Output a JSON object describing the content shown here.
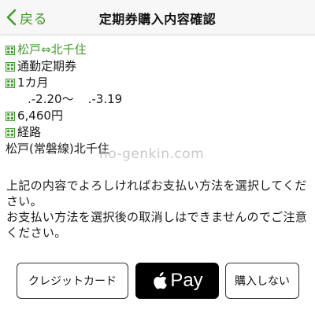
{
  "nav": {
    "back_label": "戻る",
    "title": "定期券購入内容確認"
  },
  "details": {
    "route": "松戸⇔北千住",
    "ticket_type": "通勤定期券",
    "period": "1カ月",
    "date_from": ".-2.20〜",
    "date_to": ".-3.19",
    "price": "6,460円",
    "path_label": "経路",
    "path_value": "松戸(常磐線)北千住"
  },
  "watermark": "no-genkin.com",
  "message": {
    "line1": "上記の内容でよろしければお支払い方法を選択してください。",
    "line2": "お支払い方法を選択後の取消しはできませんのでご注意ください。"
  },
  "buttons": {
    "credit_card": "クレジットカード",
    "apple_pay": "Pay",
    "cancel": "購入しない"
  },
  "colors": {
    "accent": "#3f9a2a",
    "navbar_bg": "#f7f7f7",
    "pay_button_bg": "#000000"
  },
  "icons": {
    "back": "chevron-left-icon",
    "bullet": "grid-square-icon",
    "apple": "apple-icon"
  }
}
